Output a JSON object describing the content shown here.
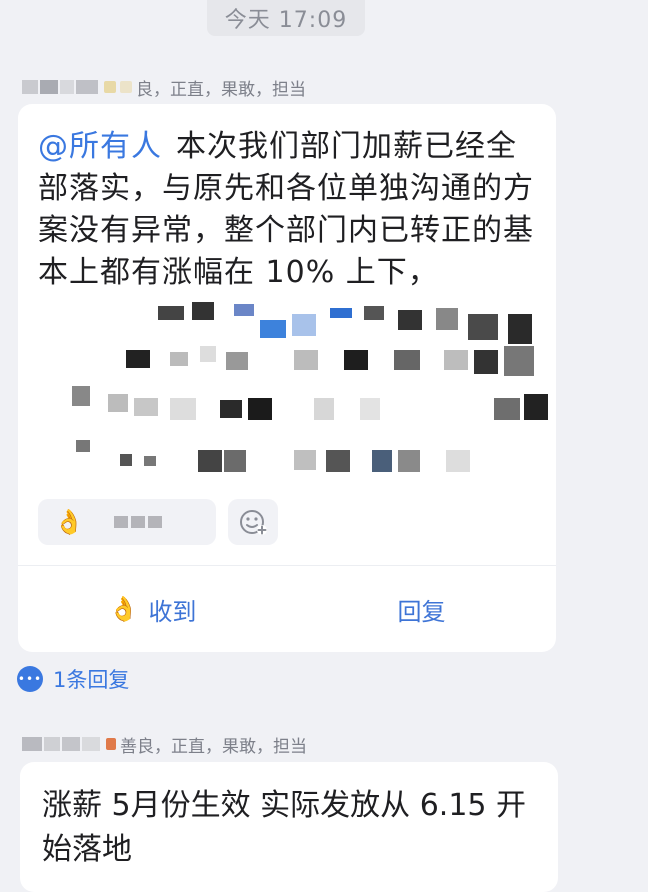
{
  "timestamp": "今天 17:09",
  "message1": {
    "sender_tags": "良，正直，果敢，担当",
    "mention": "@所有人",
    "text": "本次我们部门加薪已经全部落实，与原先和各位单独沟通的方案没有异常，整个部门内已转正的基本上都有涨幅在 10% 上下，",
    "reaction_icon": "ok-hand-icon",
    "add_reaction_icon": "emoji-add-icon",
    "actions": {
      "received_label": "收到",
      "reply_label": "回复"
    },
    "reply_count": "1条回复"
  },
  "message2": {
    "sender_tags": "善良，正直，果敢，担当",
    "text": "涨薪 5月份生效  实际发放从 6.15 开始落地"
  },
  "colors": {
    "background": "#f0f1f5",
    "card": "#ffffff",
    "accent": "#3a78e0",
    "muted_text": "#7d808a"
  }
}
